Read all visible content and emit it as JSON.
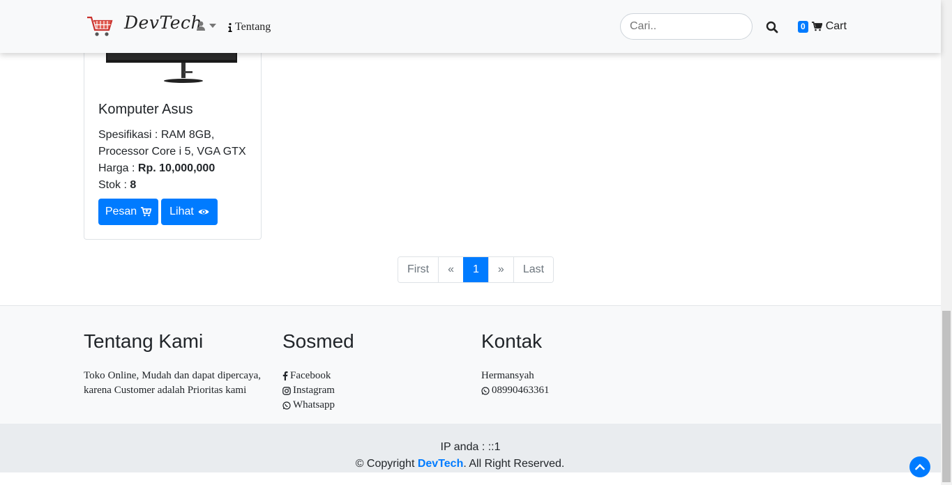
{
  "navbar": {
    "brand": "DevTech",
    "about_label": "Tentang",
    "search_placeholder": "Cari..",
    "cart_count": "0",
    "cart_label": "Cart"
  },
  "product": {
    "title": "Komputer Asus",
    "spec_label": "Spesifikasi : ",
    "spec_value": "RAM 8GB, Processor Core i 5, VGA GTX",
    "price_label": "Harga : ",
    "price_value": "Rp. 10,000,000",
    "stock_label": "Stok : ",
    "stock_value": "8",
    "order_label": "Pesan",
    "view_label": "Lihat"
  },
  "pagination": {
    "first": "First",
    "prev": "«",
    "current": "1",
    "next": "»",
    "last": "Last"
  },
  "footer": {
    "about_title": "Tentang Kami",
    "about_text": "Toko Online, Mudah dan dapat dipercaya, karena Customer adalah Prioritas kami",
    "social_title": "Sosmed",
    "social": [
      "Facebook",
      "Instagram",
      "Whatsapp"
    ],
    "contact_title": "Kontak",
    "contact_name": "Hermansyah",
    "contact_phone": "08990463361",
    "ip_text": "IP anda : ::1",
    "copyright_prefix": "© Copyright ",
    "copyright_brand": "DevTech",
    "copyright_suffix": ". All Right Reserved."
  },
  "colors": {
    "primary": "#007bff",
    "navbar_bg": "#f8f9fa",
    "footer_bottom_bg": "#e9ecef"
  }
}
